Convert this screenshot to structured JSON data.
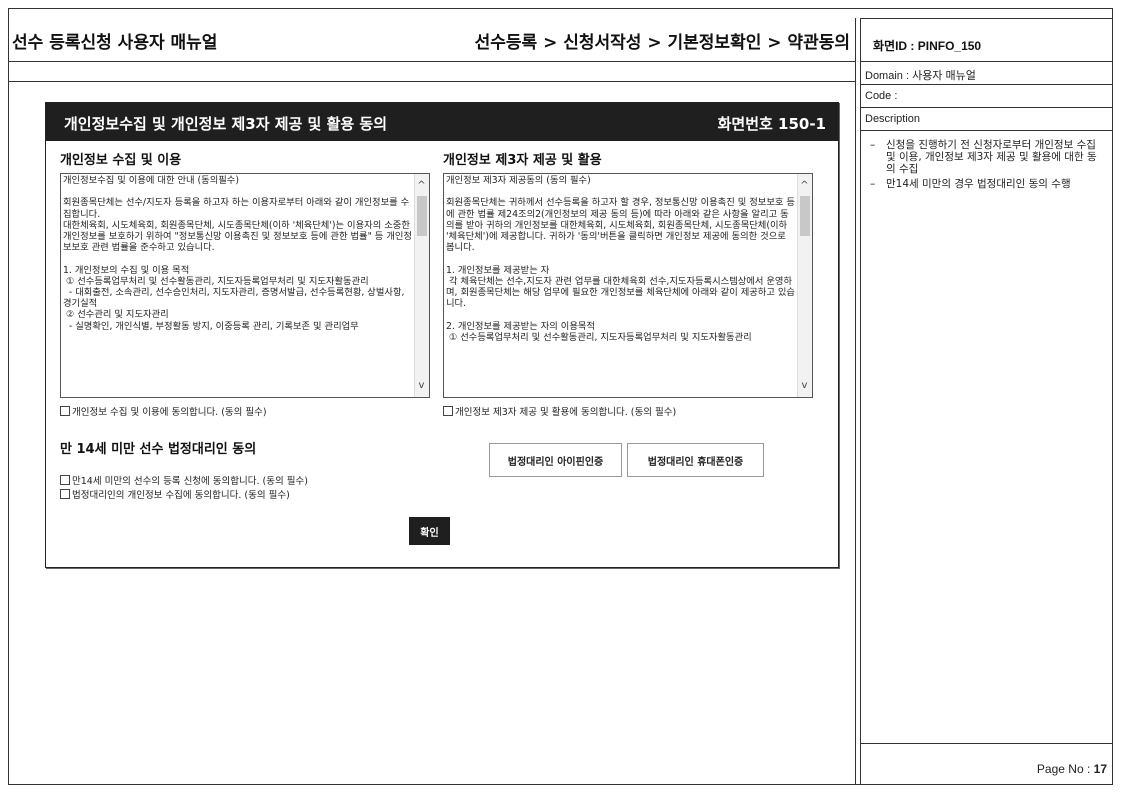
{
  "header": {
    "doc_title": "선수 등록신청 사용자 매뉴얼",
    "breadcrumb": "선수등록 > 신청서작성 > 기본정보확인 > 약관동의"
  },
  "side": {
    "screen_id": "화면ID : PINFO_150",
    "domain": "Domain : 사용자 매뉴얼",
    "code": "Code :",
    "description_label": "Description",
    "description_items": [
      "신청을 진행하기 전 신청자로부터 개인정보 수집 및 이용, 개인정보 제3자 제공 및 활용에 대한 동의 수집",
      "만14세 미만의 경우 법정대리인 동의 수행"
    ],
    "page_label": "Page No :",
    "page_number": "17"
  },
  "modal": {
    "title": "개인정보수집 및 개인정보 제3자 제공 및 활용 동의",
    "screen_number": "화면번호 150-1",
    "collection": {
      "title": "개인정보 수집 및 이용",
      "text": "개인정보수집 및 이용에 대한 안내 (동의필수)\n\n회원종목단체는 선수/지도자 등록을 하고자 하는 이용자로부터 아래와 같이 개인정보를 수집합니다.\n대한체육회, 시도체육회, 회원종목단체, 시도종목단체(이하 '체육단체')는 이용자의 소중한 개인정보를 보호하기 위하여 \"정보통신망 이용촉진 및 정보보호 등에 관한 법률\" 등 개인정보보호 관련 법률을 준수하고 있습니다.\n\n1. 개인정보의 수집 및 이용 목적\n ① 선수등록업무처리 및 선수활동관리, 지도자등록업무처리 및 지도자활동관리\n  - 대회출전, 소속관리, 선수승인처리, 지도자관리, 증명서발급, 선수등록현황, 상벌사항, 경기실적\n ② 선수관리 및 지도자관리\n  - 실명확인, 개인식별, 부정활동 방지, 이중등록 관리, 기록보존 및 관리업무",
      "agree_label": "개인정보 수집 및 이용에 동의합니다. (동의 필수)"
    },
    "third_party": {
      "title": "개인정보 제3자 제공 및 활용",
      "text": "개인정보 제3자 제공동의 (동의 필수)\n\n회원종목단체는 귀하께서 선수등록을 하고자 할 경우, 정보통신망 이용촉진 및 정보보호 등에 관한 법률 제24조의2(개인정보의 제공 동의 등)에 따라 아래와 같은 사항을 알리고 동의를 받아 귀하의 개인정보를 대한체육회, 시도체육회, 회원종목단체, 시도종목단체(이하 '체육단체')에 제공합니다. 귀하가 '동의'버튼을 클릭하면 개인정보 제공에 동의한 것으로 봅니다.\n\n1. 개인정보를 제공받는 자\n 각 체육단체는 선수,지도자 관련 업무를 대한체육회 선수,지도자등록시스템상에서 운영하며, 회원종목단체는 해당 업무에 필요한 개인정보를 체육단체에 아래와 같이 제공하고 있습니다.\n\n2. 개인정보를 제공받는 자의 이용목적\n ① 선수등록업무처리 및 선수활동관리, 지도자등록업무처리 및 지도자활동관리",
      "agree_label": "개인정보 제3자 제공 및 활용에 동의합니다. (동의 필수)"
    },
    "guardian": {
      "title": "만 14세 미만 선수 법정대리인 동의",
      "agree_minor": "만14세 미만의 선수의 등록 신청에 동의합니다. (동의 필수)",
      "agree_guardian": "법정대리인의 개인정보 수집에 동의합니다. (동의 필수)",
      "ipin_button": "법정대리인 아이핀인증",
      "phone_button": "법정대리인 휴대폰인증"
    },
    "confirm_button": "확인"
  }
}
